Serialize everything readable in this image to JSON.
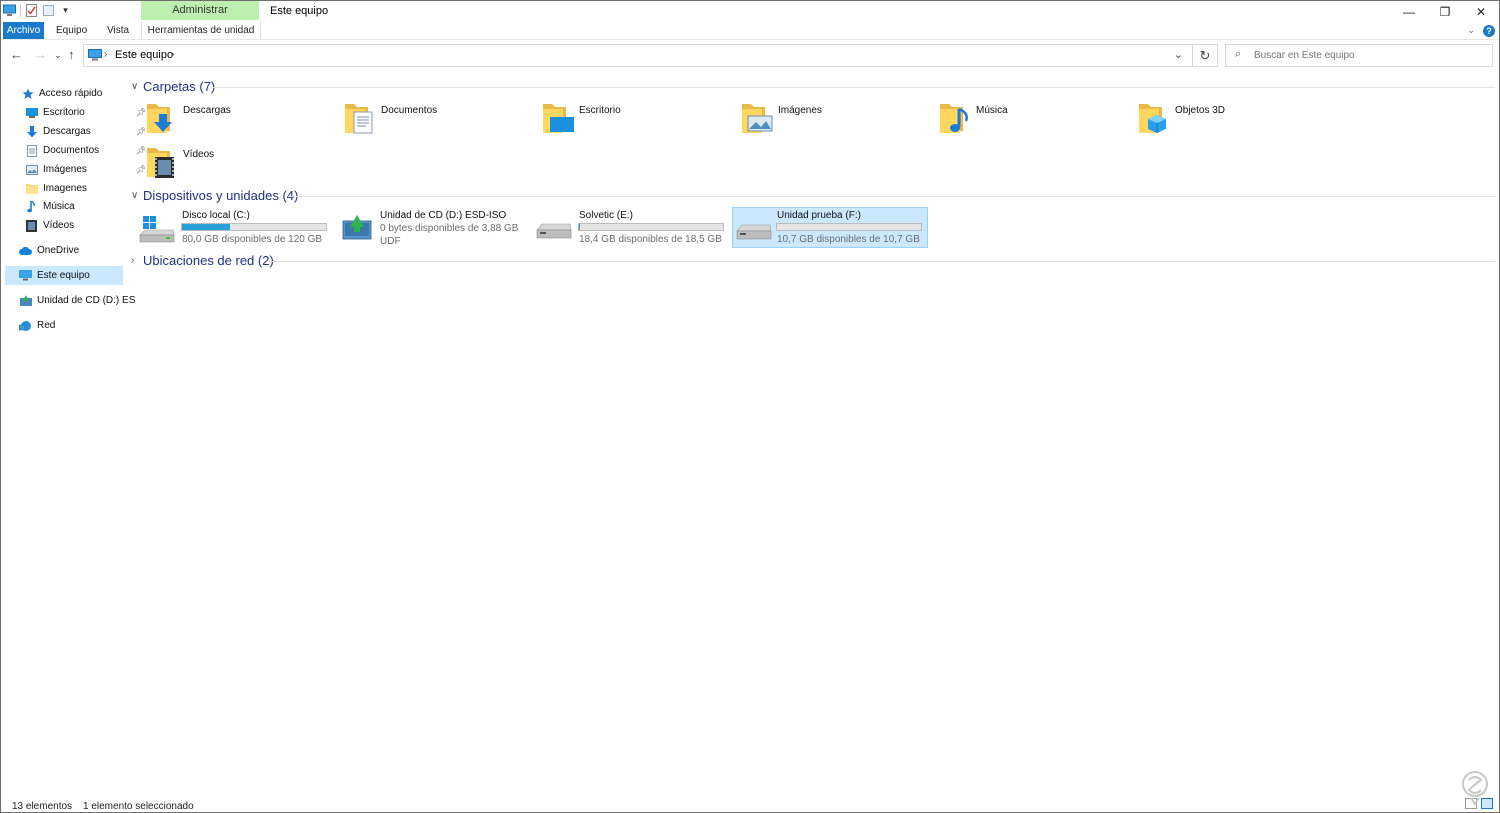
{
  "titlebar": {
    "contextual_tab": "Administrar",
    "title": "Este equipo",
    "minimize": "—",
    "restore": "❐",
    "close": "✕"
  },
  "ribbon": {
    "tabs": [
      {
        "label": "Archivo"
      },
      {
        "label": "Equipo"
      },
      {
        "label": "Vista"
      },
      {
        "label": "Herramientas de unidad"
      }
    ],
    "help": "?"
  },
  "address": {
    "location": "Este equipo",
    "search_placeholder": "Buscar en Este equipo"
  },
  "navpane": {
    "items": [
      {
        "label": "Acceso rápido",
        "icon": "star-icon"
      },
      {
        "label": "Escritorio",
        "icon": "desktop-icon",
        "pinned": true
      },
      {
        "label": "Descargas",
        "icon": "download-arrow-icon",
        "pinned": true
      },
      {
        "label": "Documentos",
        "icon": "document-icon",
        "pinned": true
      },
      {
        "label": "Imágenes",
        "icon": "pictures-icon",
        "pinned": true
      },
      {
        "label": "Imagenes",
        "icon": "folder-icon"
      },
      {
        "label": "Música",
        "icon": "music-note-icon"
      },
      {
        "label": "Vídeos",
        "icon": "video-icon"
      },
      {
        "label": "OneDrive",
        "icon": "cloud-icon"
      },
      {
        "label": "Este equipo",
        "icon": "computer-icon",
        "selected": true
      },
      {
        "label": "Unidad de CD (D:) ES",
        "icon": "cd-drive-icon"
      },
      {
        "label": "Red",
        "icon": "network-icon"
      }
    ]
  },
  "groups": {
    "folders": "Carpetas (7)",
    "devices": "Dispositivos y unidades (4)",
    "network": "Ubicaciones de red (2)"
  },
  "folders": [
    {
      "label": "Descargas",
      "icon": "downloads-folder-icon"
    },
    {
      "label": "Documentos",
      "icon": "documents-folder-icon"
    },
    {
      "label": "Escritorio",
      "icon": "desktop-folder-icon"
    },
    {
      "label": "Imágenes",
      "icon": "pictures-folder-icon"
    },
    {
      "label": "Música",
      "icon": "music-folder-icon"
    },
    {
      "label": "Objetos 3D",
      "icon": "3d-objects-folder-icon"
    },
    {
      "label": "Vídeos",
      "icon": "videos-folder-icon"
    }
  ],
  "drives": [
    {
      "name": "Disco local (C:)",
      "free": "80,0 GB disponibles de 120 GB",
      "used_fraction": 0.33,
      "icon": "windows-drive-icon"
    },
    {
      "name": "Unidad de CD (D:) ESD-ISO",
      "free": "0 bytes disponibles de 3,88 GB",
      "fs": "UDF",
      "icon": "cd-drive-icon"
    },
    {
      "name": "Solvetic (E:)",
      "free": "18,4 GB disponibles de 18,5 GB",
      "used_fraction": 0.005,
      "icon": "hard-drive-icon"
    },
    {
      "name": "Unidad prueba (F:)",
      "free": "10,7 GB disponibles de 10,7 GB",
      "used_fraction": 0.0,
      "icon": "hard-drive-icon",
      "selected": true
    }
  ],
  "status": {
    "count": "13 elementos",
    "selection": "1 elemento seleccionado"
  },
  "colors": {
    "accent": "#1979ca",
    "bar_fill": "#26a0da",
    "selection": "#cce8ff",
    "group_heading": "#1e3287"
  }
}
